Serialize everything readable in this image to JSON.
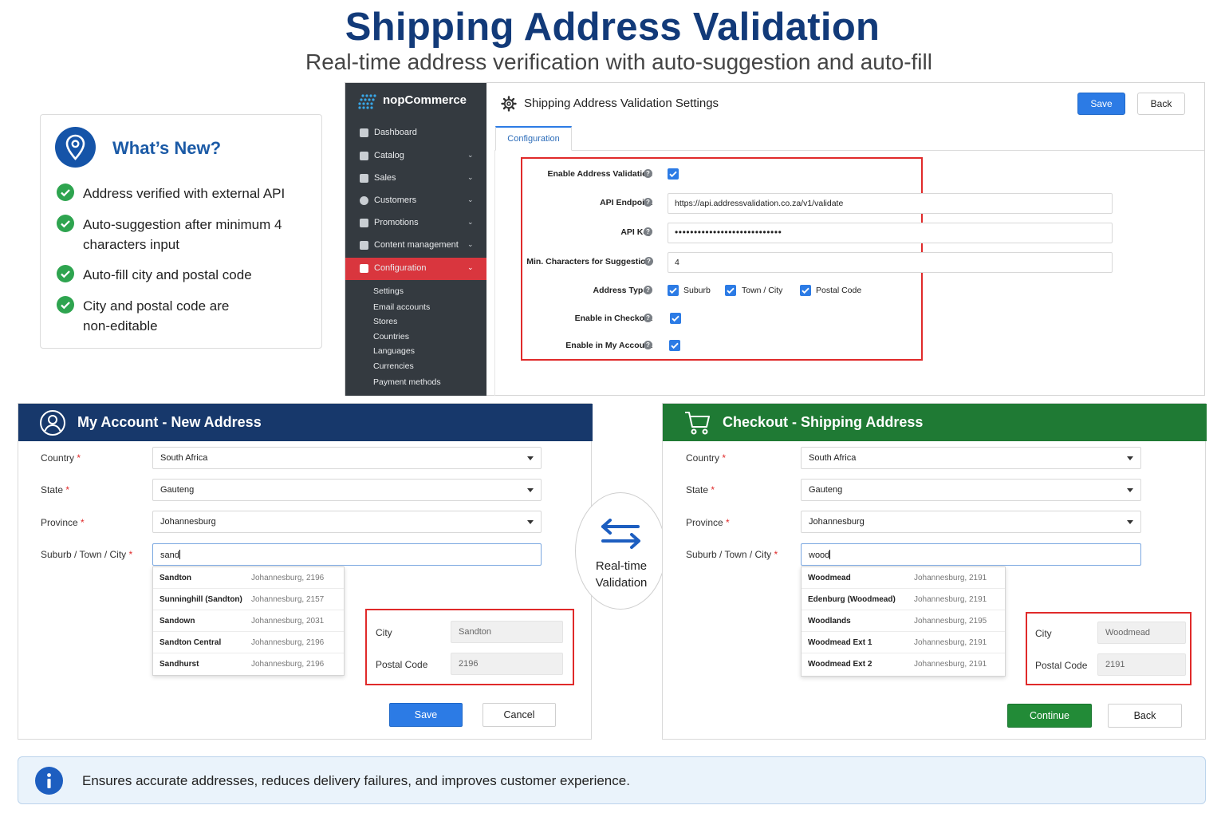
{
  "header": {
    "title": "Shipping Address Validation",
    "subtitle": "Real-time address verification with auto-suggestion and auto-fill"
  },
  "whats_new": {
    "title": "What’s New?",
    "icon": "location-pin-icon",
    "items": [
      "Address verified with external API",
      "Auto-suggestion after minimum 4 characters input",
      "Auto-fill city and postal code",
      "City and postal code are non-editable"
    ]
  },
  "admin": {
    "brand": "nopCommerce",
    "title": "Shipping Address Validation Settings",
    "save_label": "Save",
    "back_label": "Back",
    "tab": "Configuration",
    "nav": [
      {
        "label": "Dashboard",
        "icon": "dashboard-icon",
        "chevron": false
      },
      {
        "label": "Catalog",
        "icon": "catalog-icon",
        "chevron": true
      },
      {
        "label": "Sales",
        "icon": "cart-icon",
        "chevron": true
      },
      {
        "label": "Customers",
        "icon": "user-icon",
        "chevron": true
      },
      {
        "label": "Promotions",
        "icon": "tag-icon",
        "chevron": true
      },
      {
        "label": "Content management",
        "icon": "content-icon",
        "chevron": true
      },
      {
        "label": "Configuration",
        "icon": "config-icon",
        "chevron": true
      }
    ],
    "sub_nav": [
      "Settings",
      "Email accounts",
      "Stores",
      "Countries",
      "Languages",
      "Currencies",
      "Payment methods"
    ],
    "fields": {
      "enable_label": "Enable Address Validation",
      "endpoint_label": "API Endpoint",
      "endpoint_value": "https://api.addressvalidation.co.za/v1/validate",
      "key_label": "API Key",
      "key_value": "••••••••••••••••••••••••••••",
      "minchars_label": "Min. Characters for Suggestion",
      "minchars_value": "4",
      "types_label": "Address Types",
      "type_suburb": "Suburb",
      "type_town": "Town / City",
      "type_postal": "Postal Code",
      "checkout_label": "Enable in Checkout",
      "myaccount_label": "Enable in My Account"
    }
  },
  "my_account": {
    "title": "My Account - New Address",
    "country_label": "Country",
    "country_value": "South Africa",
    "state_label": "State",
    "state_value": "Gauteng",
    "province_label": "Province",
    "province_value": "Johannesburg",
    "suburb_label": "Suburb / Town / City",
    "suburb_value": "sand",
    "suggestions": [
      {
        "name": "Sandton",
        "meta": "Johannesburg, 2196"
      },
      {
        "name": "Sunninghill (Sandton)",
        "meta": "Johannesburg, 2157"
      },
      {
        "name": "Sandown",
        "meta": "Johannesburg, 2031"
      },
      {
        "name": "Sandton Central",
        "meta": "Johannesburg, 2196"
      },
      {
        "name": "Sandhurst",
        "meta": "Johannesburg, 2196"
      }
    ],
    "city_label": "City",
    "city_value": "Sandton",
    "postal_label": "Postal Code",
    "postal_value": "2196",
    "save_label": "Save",
    "cancel_label": "Cancel"
  },
  "center": {
    "line1": "Real-time",
    "line2": "Validation"
  },
  "checkout": {
    "title": "Checkout - Shipping Address",
    "country_label": "Country",
    "country_value": "South Africa",
    "state_label": "State",
    "state_value": "Gauteng",
    "province_label": "Province",
    "province_value": "Johannesburg",
    "suburb_label": "Suburb / Town / City",
    "suburb_value": "wood",
    "suggestions": [
      {
        "name": "Woodmead",
        "meta": "Johannesburg, 2191"
      },
      {
        "name": "Edenburg (Woodmead)",
        "meta": "Johannesburg, 2191"
      },
      {
        "name": "Woodlands",
        "meta": "Johannesburg, 2195"
      },
      {
        "name": "Woodmead Ext 1",
        "meta": "Johannesburg, 2191"
      },
      {
        "name": "Woodmead Ext 2",
        "meta": "Johannesburg, 2191"
      }
    ],
    "city_label": "City",
    "city_value": "Woodmead",
    "postal_label": "Postal Code",
    "postal_value": "2191",
    "continue_label": "Continue",
    "back_label": "Back"
  },
  "banner": {
    "text": "Ensures accurate addresses, reduces delivery failures, and improves customer experience."
  },
  "colors": {
    "title_blue": "#123a79",
    "account_header": "#17386b",
    "checkout_header": "#1f7a34",
    "primary_button": "#2c7be5",
    "continue_button": "#228b37",
    "highlight_red": "#e02a2a",
    "sidebar": "#343a40",
    "sidebar_active": "#d9363e"
  }
}
